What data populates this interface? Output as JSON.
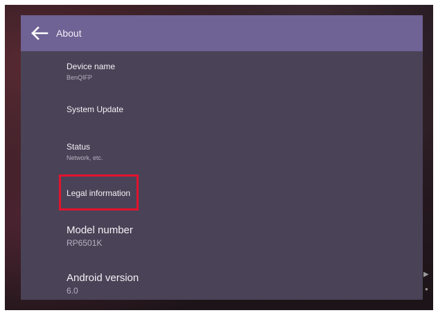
{
  "header": {
    "title": "About"
  },
  "items": [
    {
      "title": "Device name",
      "subtitle": "BenQIFP"
    },
    {
      "title": "System Update"
    },
    {
      "title": "Status",
      "subtitle": "Network, etc."
    },
    {
      "title": "Legal information"
    },
    {
      "title": "Model number",
      "subtitle": "RP6501K"
    },
    {
      "title": "Android version",
      "subtitle": "6.0"
    }
  ],
  "colors": {
    "header": "#6f6294",
    "panel": "#4a4357",
    "highlight": "#e3132e"
  }
}
